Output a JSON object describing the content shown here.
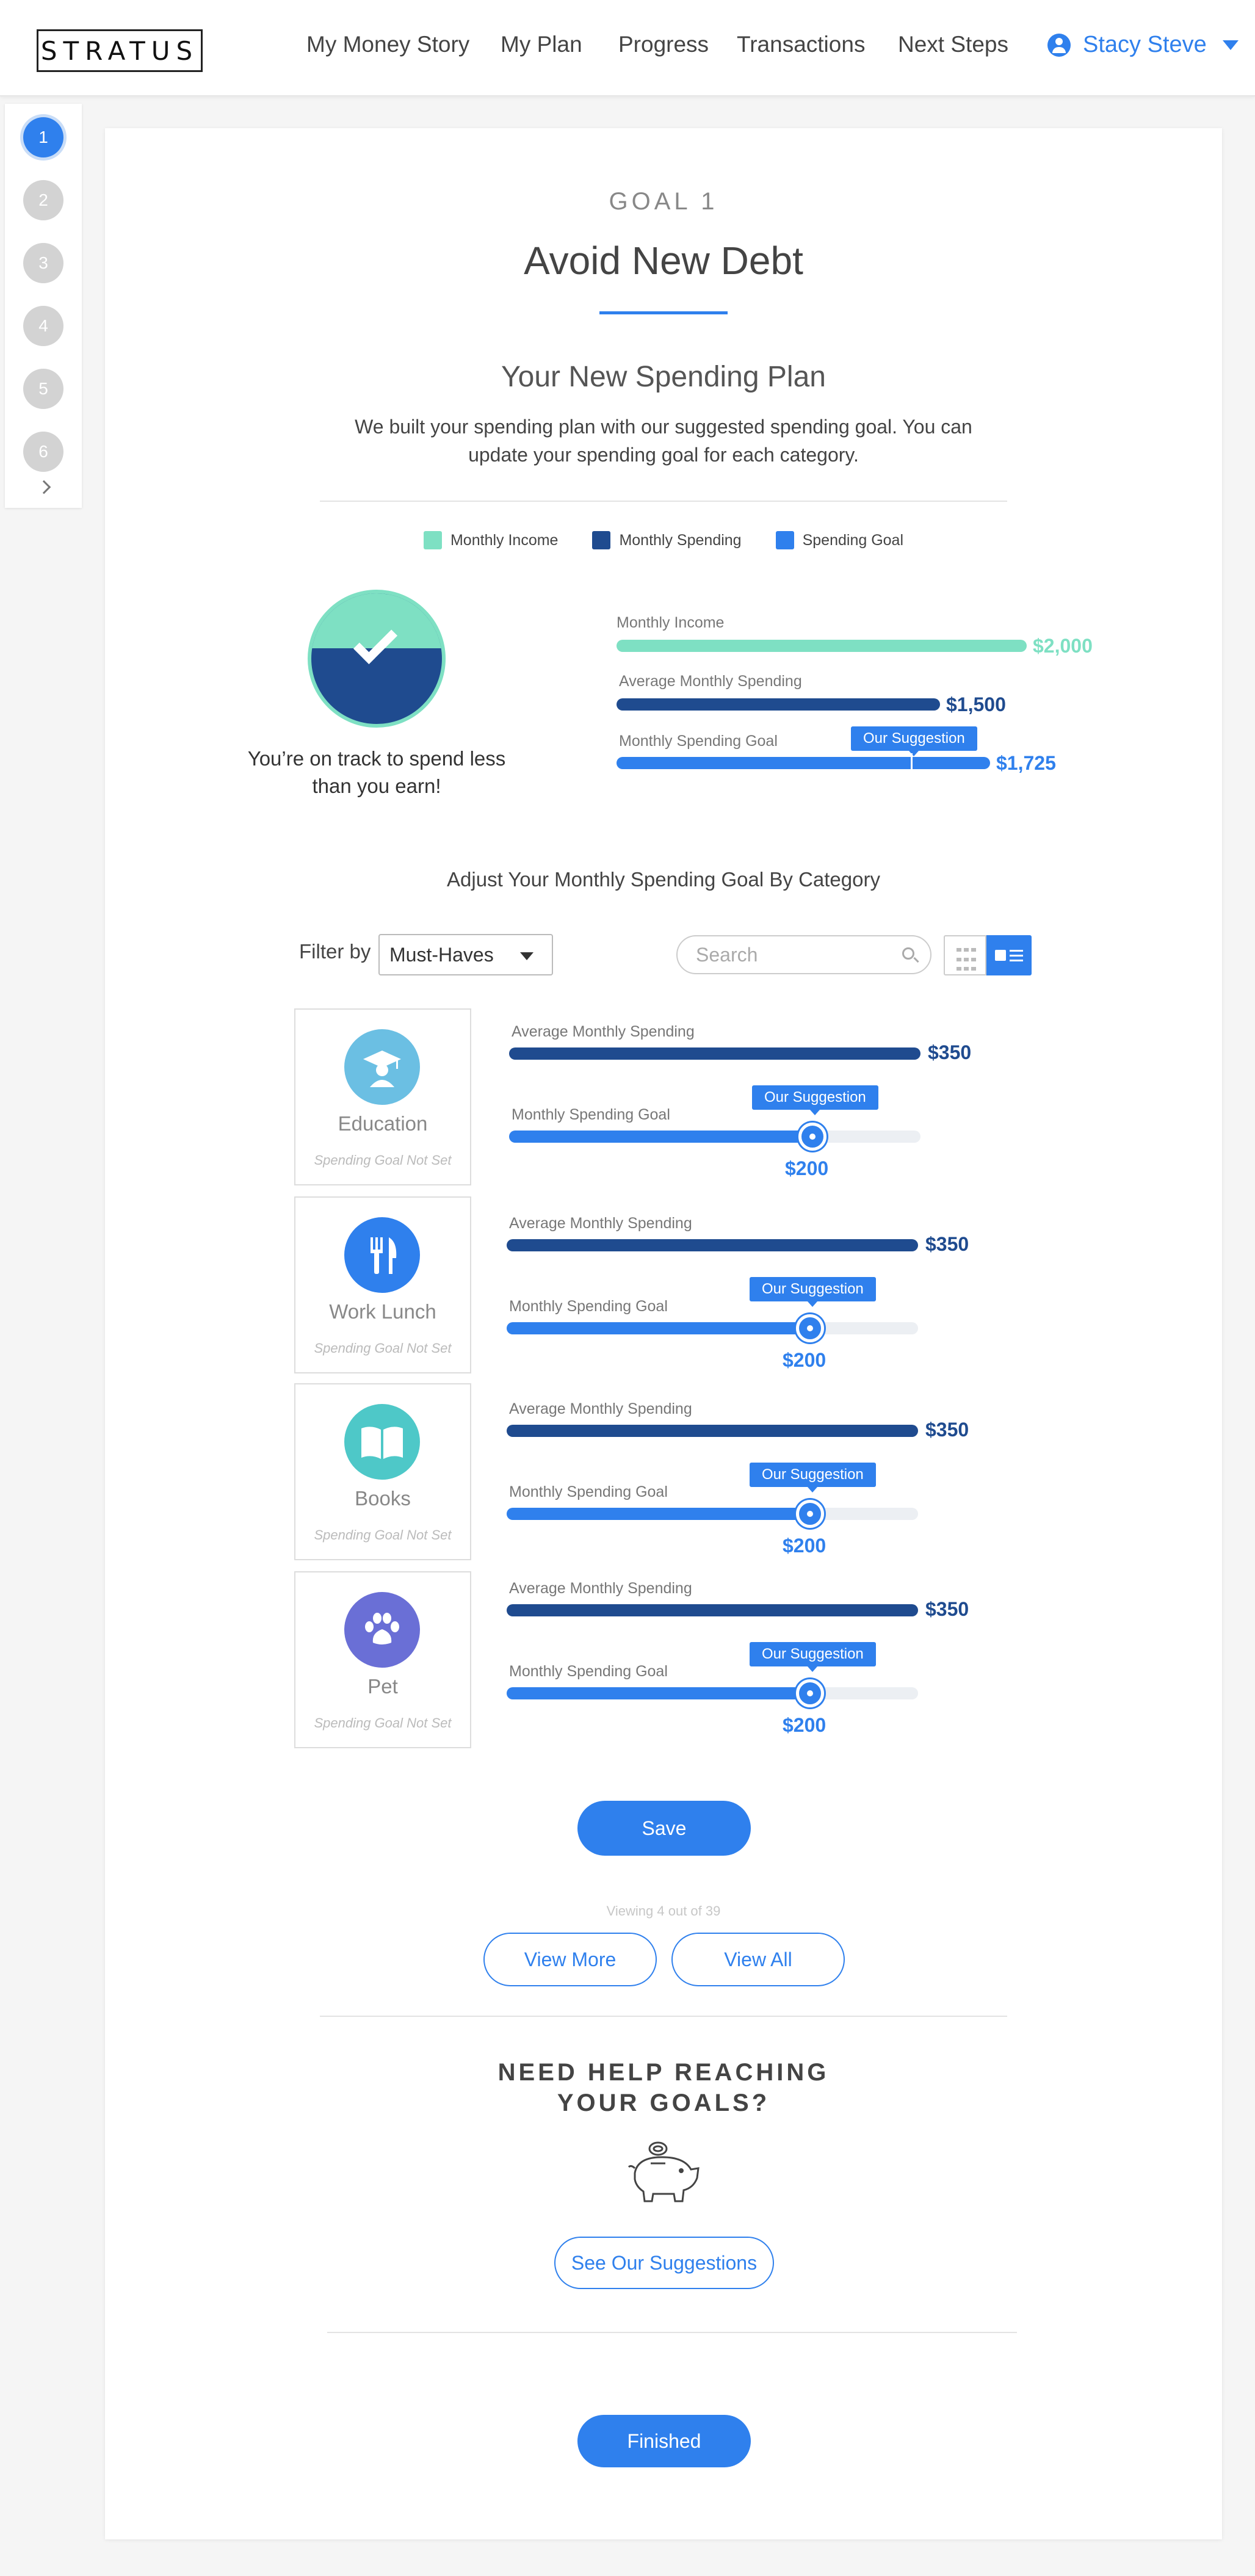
{
  "brand": {
    "logo": "STRATUS"
  },
  "nav": {
    "items": [
      "My Money Story",
      "My Plan",
      "Progress",
      "Transactions",
      "Next Steps"
    ],
    "user_name": "Stacy Steve"
  },
  "steps": [
    "1",
    "2",
    "3",
    "4",
    "5",
    "6"
  ],
  "goal": {
    "label": "GOAL 1",
    "title": "Avoid New Debt"
  },
  "plan": {
    "heading": "Your New Spending Plan",
    "description": "We built your spending plan with our suggested spending goal. You can update your spending goal for each category."
  },
  "legend": [
    {
      "label": "Monthly Income",
      "color": "#7ee0c3"
    },
    {
      "label": "Monthly Spending",
      "color": "#1f4b8f"
    },
    {
      "label": "Spending Goal",
      "color": "#2f80ed"
    }
  ],
  "status": {
    "message": "You’re on track to spend less than you earn!"
  },
  "summary": {
    "income_label": "Monthly Income",
    "income_value": "$2,000",
    "spending_label": "Average Monthly Spending",
    "spending_value": "$1,500",
    "goal_label": "Monthly Spending Goal",
    "goal_value": "$1,725",
    "suggestion_label": "Our Suggestion",
    "income_fraction": 1.0,
    "spending_fraction": 0.79,
    "goal_fraction": 0.91,
    "suggestion_marker_fraction": 0.72
  },
  "adjust": {
    "heading": "Adjust Your Monthly Spending Goal By Category",
    "filter_label": "Filter by",
    "filter_value": "Must-Haves",
    "search_placeholder": "Search"
  },
  "categories": [
    {
      "name": "Education",
      "status": "Spending Goal Not Set",
      "icon": "graduation-cap-icon",
      "icon_color": "#6bbfe3",
      "avg_label": "Average Monthly Spending",
      "avg_value": "$350",
      "goal_label": "Monthly Spending Goal",
      "goal_value": "$200",
      "suggestion": "Our Suggestion",
      "goal_fraction": 0.74
    },
    {
      "name": "Work Lunch",
      "status": "Spending Goal Not Set",
      "icon": "fork-knife-icon",
      "icon_color": "#2f80ed",
      "avg_label": "Average Monthly Spending",
      "avg_value": "$350",
      "goal_label": "Monthly Spending Goal",
      "goal_value": "$200",
      "suggestion": "Our Suggestion",
      "goal_fraction": 0.74
    },
    {
      "name": "Books",
      "status": "Spending Goal Not Set",
      "icon": "book-icon",
      "icon_color": "#4ec8c8",
      "avg_label": "Average Monthly Spending",
      "avg_value": "$350",
      "goal_label": "Monthly Spending Goal",
      "goal_value": "$200",
      "suggestion": "Our Suggestion",
      "goal_fraction": 0.74
    },
    {
      "name": "Pet",
      "status": "Spending Goal Not Set",
      "icon": "paw-icon",
      "icon_color": "#6a6fd6",
      "avg_label": "Average Monthly Spending",
      "avg_value": "$350",
      "goal_label": "Monthly Spending Goal",
      "goal_value": "$200",
      "suggestion": "Our Suggestion",
      "goal_fraction": 0.74
    }
  ],
  "actions": {
    "save": "Save",
    "viewing": "Viewing 4 out of 39",
    "view_more": "View More",
    "view_all": "View All"
  },
  "help": {
    "heading_line1": "NEED HELP REACHING",
    "heading_line2": "YOUR GOALS?",
    "icon": "piggy-bank-icon",
    "button": "See Our Suggestions"
  },
  "finish": {
    "button": "Finished"
  }
}
